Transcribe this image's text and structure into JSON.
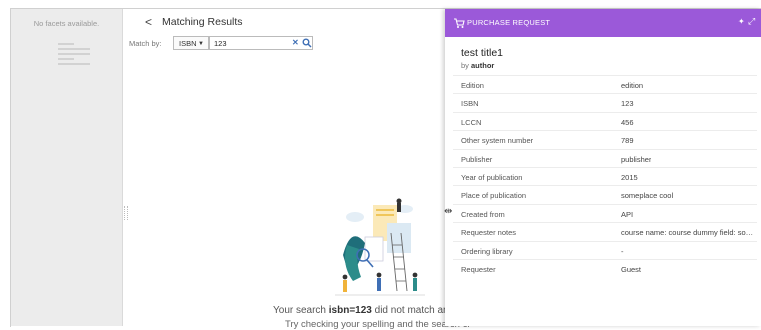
{
  "facets": {
    "empty_text": "No facets available."
  },
  "results": {
    "back_glyph": "<",
    "title": "Matching Results",
    "match_by_label": "Match by:",
    "match_by_value": "ISBN",
    "search_value": "123",
    "clear_glyph": "✕",
    "empty_prefix": "Your search ",
    "empty_query": "isbn=123",
    "empty_suffix": " did not match any",
    "empty_hint": "Try checking your spelling and the search cr"
  },
  "panel": {
    "title": "PURCHASE REQUEST",
    "record_title": "test title1",
    "by_prefix": "by ",
    "author": "author",
    "rows": [
      {
        "key": "Edition",
        "value": "edition"
      },
      {
        "key": "ISBN",
        "value": "123"
      },
      {
        "key": "LCCN",
        "value": "456"
      },
      {
        "key": "Other system number",
        "value": "789"
      },
      {
        "key": "Publisher",
        "value": "publisher"
      },
      {
        "key": "Year of publication",
        "value": "2015"
      },
      {
        "key": "Place of publication",
        "value": "someplace cool"
      },
      {
        "key": "Created from",
        "value": "API"
      },
      {
        "key": "Requester notes",
        "value": "course name: course dummy field: somet..."
      },
      {
        "key": "Ordering library",
        "value": "-"
      },
      {
        "key": "Requester",
        "value": "Guest"
      }
    ]
  },
  "colors": {
    "header": "#9b59d9",
    "link": "#3f6fb5"
  },
  "icons": [
    "cart-icon",
    "pin-icon",
    "expand-icon",
    "search-icon",
    "clear-icon",
    "resize-handle-icon"
  ]
}
